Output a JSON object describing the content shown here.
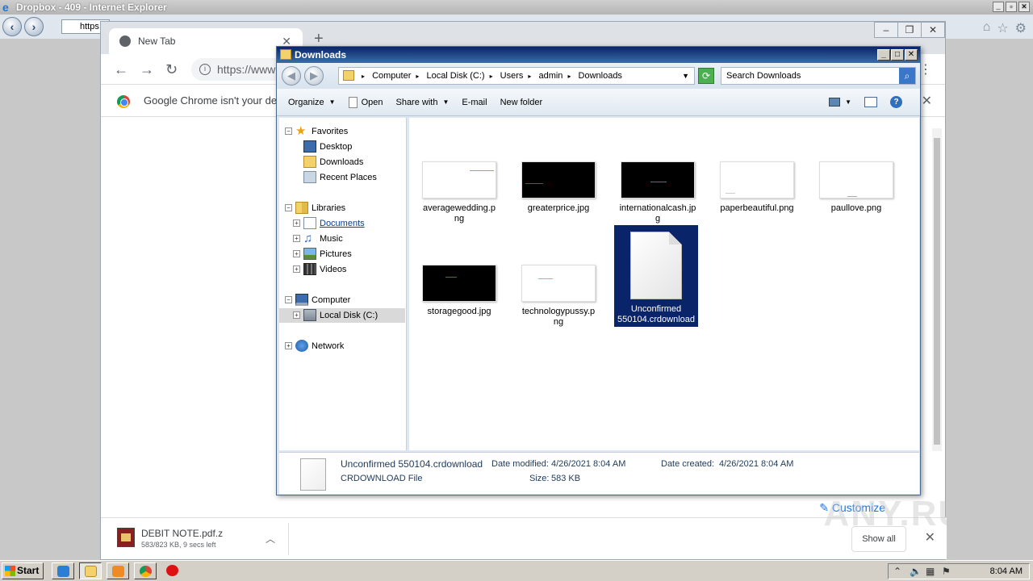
{
  "ie": {
    "title": "Dropbox - 409 - Internet Explorer",
    "address": "https"
  },
  "chrome": {
    "tab_title": "New Tab",
    "url": "https://www",
    "infobar_text": "Google Chrome isn't your defa",
    "customize_label": "Customize",
    "download": {
      "name": "DEBIT NOTE.pdf.z",
      "status": "583/823 KB, 9 secs left"
    },
    "show_all_label": "Show all"
  },
  "explorer": {
    "title": "Downloads",
    "breadcrumbs": [
      "Computer",
      "Local Disk (C:)",
      "Users",
      "admin",
      "Downloads"
    ],
    "search_placeholder": "Search Downloads",
    "commands": {
      "organize": "Organize",
      "open": "Open",
      "share_with": "Share with",
      "email": "E-mail",
      "new_folder": "New folder"
    },
    "nav": {
      "favorites": "Favorites",
      "desktop": "Desktop",
      "downloads": "Downloads",
      "recent_places": "Recent Places",
      "libraries": "Libraries",
      "documents": "Documents",
      "music": "Music",
      "pictures": "Pictures",
      "videos": "Videos",
      "computer": "Computer",
      "local_disk": "Local Disk (C:)",
      "network": "Network"
    },
    "files": [
      {
        "name_l1": "averagewedding.p",
        "name_l2": "ng",
        "thumb": "white"
      },
      {
        "name_l1": "greaterprice.jpg",
        "name_l2": "",
        "thumb": "black"
      },
      {
        "name_l1": "internationalcash.jp",
        "name_l2": "g",
        "thumb": "black"
      },
      {
        "name_l1": "paperbeautiful.png",
        "name_l2": "",
        "thumb": "white"
      },
      {
        "name_l1": "paullove.png",
        "name_l2": "",
        "thumb": "white"
      },
      {
        "name_l1": "storagegood.jpg",
        "name_l2": "",
        "thumb": "black"
      },
      {
        "name_l1": "technologypussy.p",
        "name_l2": "ng",
        "thumb": "white"
      },
      {
        "name_l1": "Unconfirmed",
        "name_l2": "550104.crdownload",
        "thumb": "doc"
      }
    ],
    "details": {
      "filename": "Unconfirmed 550104.crdownload",
      "type": "CRDOWNLOAD File",
      "modified_label": "Date modified:",
      "modified_value": "4/26/2021 8:04 AM",
      "size_label": "Size:",
      "size_value": "583 KB",
      "created_label": "Date created:",
      "created_value": "4/26/2021 8:04 AM"
    }
  },
  "taskbar": {
    "start_label": "Start",
    "clock": "8:04 AM"
  },
  "watermark": "ANY.RUN",
  "colors": {
    "selection": "#0a246a",
    "chrome_link": "#1a73e8",
    "explorer_title": "#0a246a"
  }
}
